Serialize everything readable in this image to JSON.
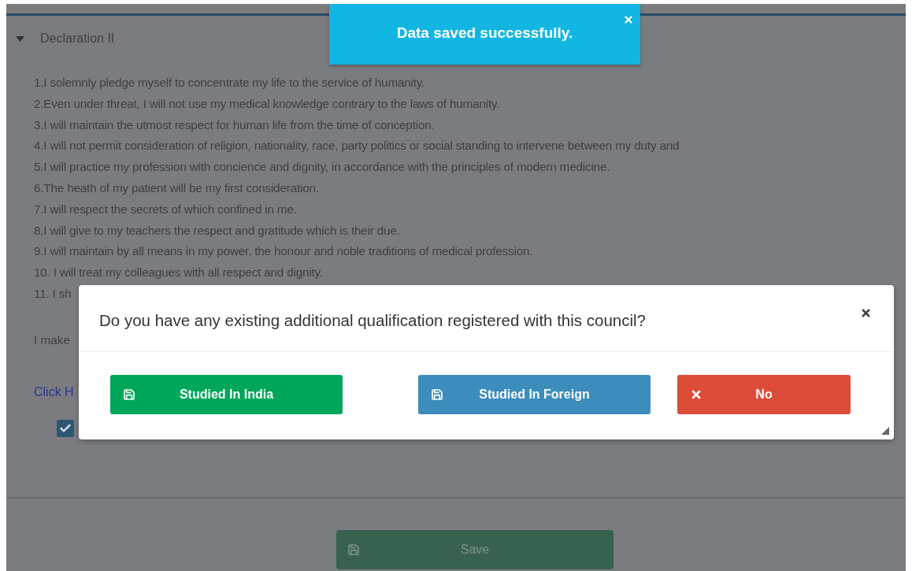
{
  "toast": {
    "message": "Data saved successfully."
  },
  "section": {
    "title": "Declaration II",
    "expanded": true,
    "items": [
      "1.I solemnly pledge myself to concentrate my life to the service of humanity.",
      "2.Even under threat, I will not use my medical knowledge contrary to the laws of humanity.",
      "3.I will maintain the utmost respect for human life from the time of conception.",
      "4.I will not permit consideration of religion, nationality, race, party politics or social standing to intervene between my duty and",
      "5.I will practice my profession with concience and dignity, in accordance with the principles of modern medicine.",
      "6.The heath of my patient will be my first consideration.",
      "7.I will respect the secrets of which confined in me.",
      "8.I will give to my teachers the respect and gratitude which is their due.",
      "9.I will maintain by all means in my power, the honour and noble traditions of medical profession.",
      "10. I will treat my colleagues with all respect and dignity.",
      "11. I sh"
    ],
    "statement": "I make",
    "link": "Click H",
    "agree": {
      "checked": true
    }
  },
  "save": {
    "label": "Save"
  },
  "modal": {
    "question": "Do you have any existing additional qualification registered with this council?",
    "buttons": [
      {
        "label": "Studied In India",
        "kind": "success"
      },
      {
        "label": "Studied In Foreign",
        "kind": "primary"
      },
      {
        "label": "No",
        "kind": "danger"
      }
    ]
  }
}
